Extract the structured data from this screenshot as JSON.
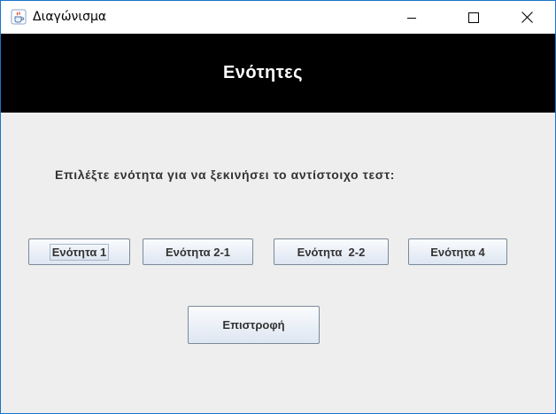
{
  "window": {
    "title": "Διαγώνισμα",
    "icon": "java-cup-icon",
    "controls": [
      "minimize-icon",
      "maximize-icon",
      "close-icon"
    ]
  },
  "header": {
    "title": "Ενότητες",
    "background": "#000000",
    "text_color": "#ffffff"
  },
  "main": {
    "prompt": "Επιλέξτε ενότητα για να ξεκινήσει το αντίστοιχο τεστ:",
    "section_buttons": [
      {
        "label": "Ενότητα 1",
        "focused": true
      },
      {
        "label": "Ενότητα 2-1",
        "focused": false
      },
      {
        "label": "Ενότητα  2-2",
        "focused": false
      },
      {
        "label": "Ενότητα 4",
        "focused": false
      }
    ],
    "back_button": "Επιστροφή",
    "background": "#eeeeee"
  }
}
